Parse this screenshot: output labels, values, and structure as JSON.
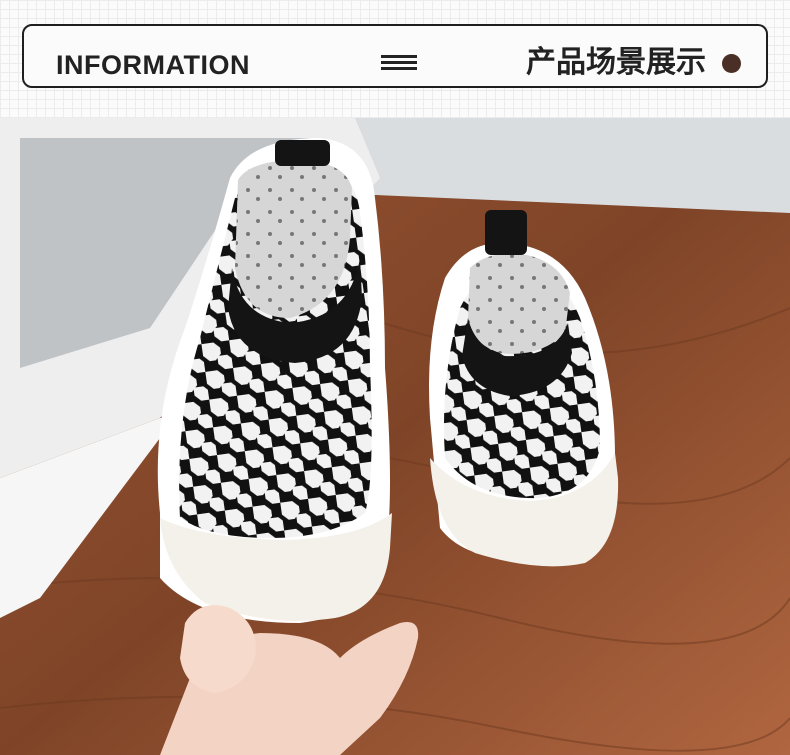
{
  "header": {
    "title_en": "INFORMATION",
    "title_cn": "产品场景展示"
  },
  "colors": {
    "accent_brown": "#5a3f35",
    "dot": "#4a2f26",
    "border": "#1f1f1f",
    "wood": "#8b4a2d"
  },
  "icons": [
    "menu-icon",
    "dot-icon"
  ]
}
